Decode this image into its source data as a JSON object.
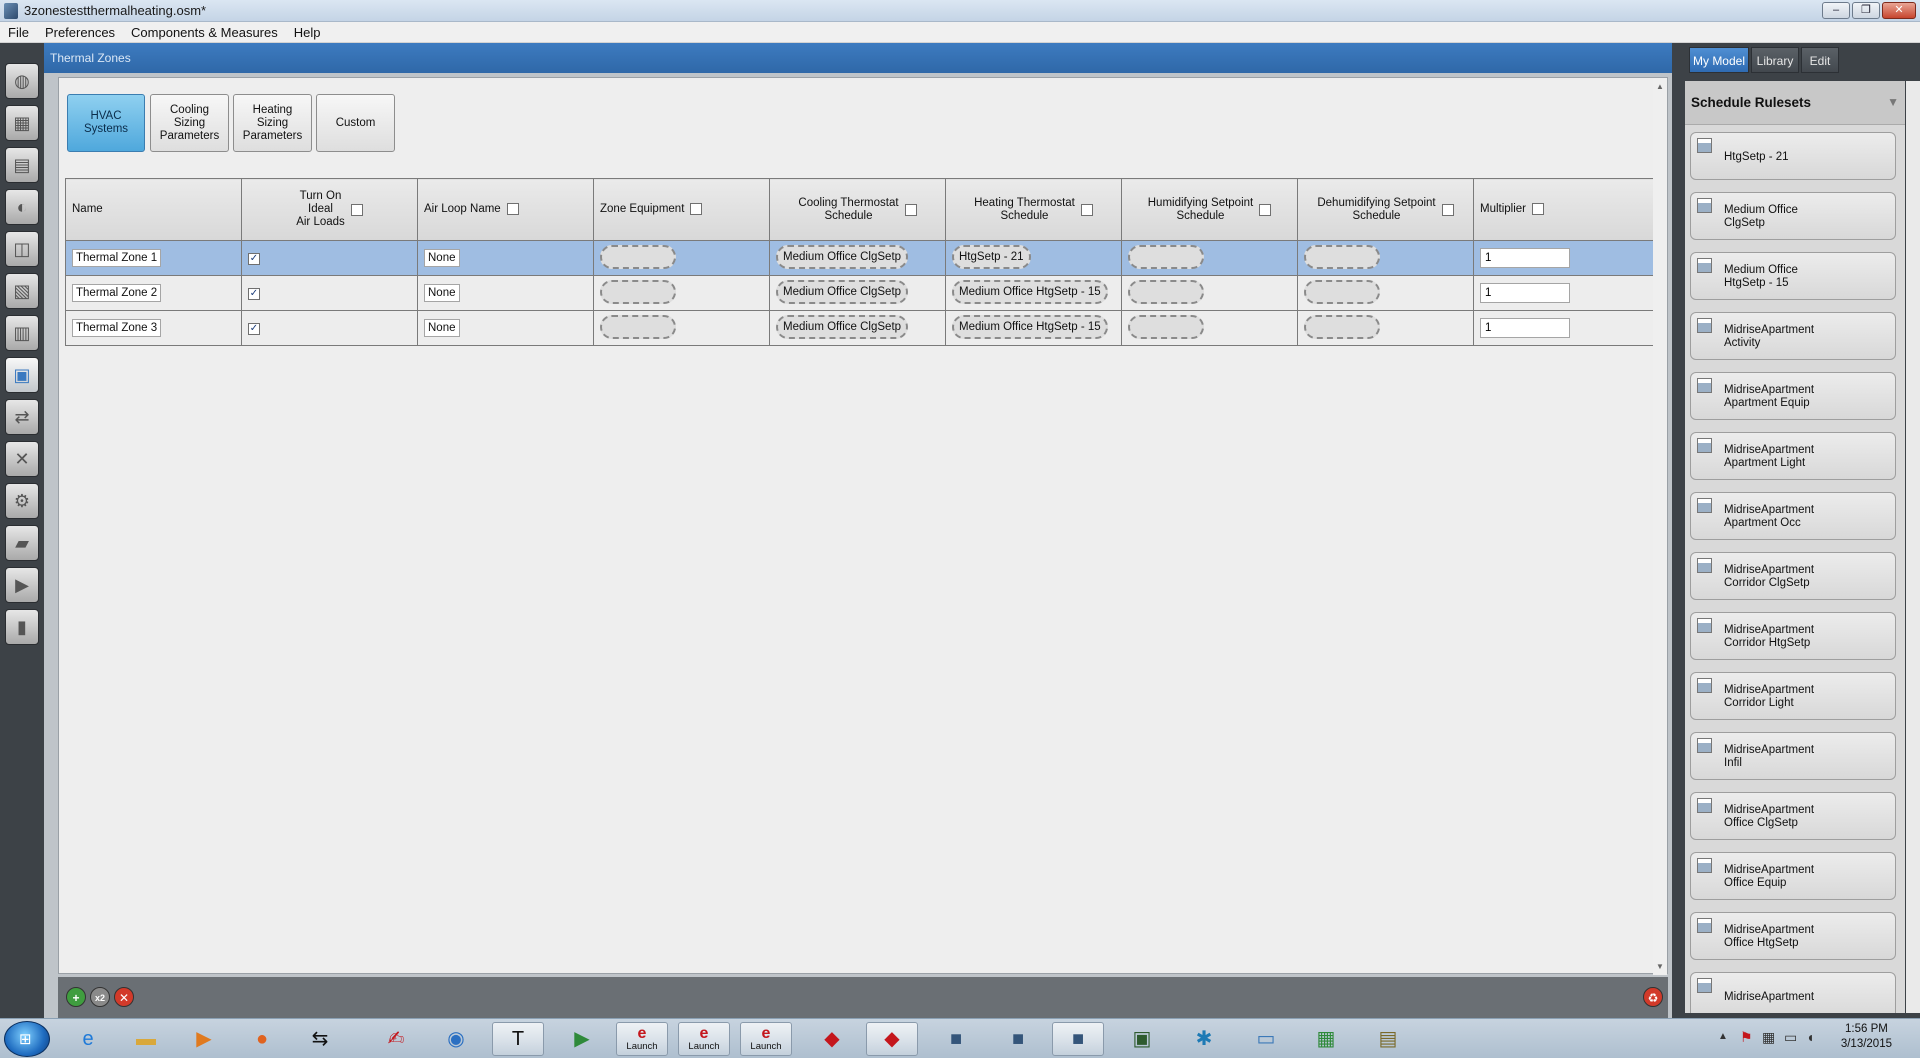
{
  "window": {
    "title": "3zonestestthermalheating.osm*",
    "controls": {
      "minimize": "–",
      "maximize": "❐",
      "close": "✕"
    }
  },
  "menu": [
    "File",
    "Preferences",
    "Components & Measures",
    "Help"
  ],
  "left_icons": [
    "globe-icon",
    "calendar-icon",
    "construction-icon",
    "loads-icon",
    "space-types-icon",
    "geometry-icon",
    "facility-icon",
    "spaces-icon",
    "thermal-zones-icon",
    "hvac-icon",
    "tools-icon",
    "measures-icon",
    "scripts-icon",
    "run-icon",
    "results-icon"
  ],
  "section": {
    "title": "Thermal Zones"
  },
  "subtabs": [
    {
      "label": "HVAC\nSystems",
      "active": true
    },
    {
      "label": "Cooling\nSizing\nParameters",
      "active": false
    },
    {
      "label": "Heating\nSizing\nParameters",
      "active": false
    },
    {
      "label": "Custom",
      "active": false
    }
  ],
  "table": {
    "headers": {
      "name": "Name",
      "ideal_loads": "Turn On\nIdeal\nAir Loads",
      "air_loop": "Air Loop Name",
      "zone_equipment": "Zone Equipment",
      "cooling_sched": "Cooling Thermostat\nSchedule",
      "heating_sched": "Heating Thermostat\nSchedule",
      "humid_sched": "Humidifying Setpoint\nSchedule",
      "dehumid_sched": "Dehumidifying Setpoint\nSchedule",
      "multiplier": "Multiplier"
    },
    "rows": [
      {
        "name": "Thermal Zone 1",
        "ideal": "✓",
        "air_loop": "None",
        "cooling": "Medium Office ClgSetp",
        "heating": "HtgSetp - 21",
        "multiplier": "1",
        "selected": true
      },
      {
        "name": "Thermal Zone 2",
        "ideal": "✓",
        "air_loop": "None",
        "cooling": "Medium Office ClgSetp",
        "heating": "Medium Office HtgSetp - 15",
        "multiplier": "1",
        "selected": false
      },
      {
        "name": "Thermal Zone 3",
        "ideal": "✓",
        "air_loop": "None",
        "cooling": "Medium Office ClgSetp",
        "heating": "Medium Office HtgSetp - 15",
        "multiplier": "1",
        "selected": false
      }
    ]
  },
  "bottom_buttons": {
    "add": "+",
    "copy": "x2",
    "remove": "✕",
    "purge": "♻"
  },
  "right_panel": {
    "tabs": [
      "My Model",
      "Library",
      "Edit"
    ],
    "list_title": "Schedule Rulesets",
    "items": [
      "HtgSetp - 21",
      "Medium Office\nClgSetp",
      "Medium Office\nHtgSetp - 15",
      "MidriseApartment\nActivity",
      "MidriseApartment\nApartment Equip",
      "MidriseApartment\nApartment Light",
      "MidriseApartment\nApartment Occ",
      "MidriseApartment\nCorridor ClgSetp",
      "MidriseApartment\nCorridor HtgSetp",
      "MidriseApartment\nCorridor Light",
      "MidriseApartment\nInfil",
      "MidriseApartment\nOffice ClgSetp",
      "MidriseApartment\nOffice Equip",
      "MidriseApartment\nOffice HtgSetp",
      "MidriseApartment"
    ]
  },
  "taskbar": {
    "launch_label": "Launch",
    "time": "1:56 PM",
    "date": "3/13/2015",
    "tray_arrow": "▲"
  }
}
